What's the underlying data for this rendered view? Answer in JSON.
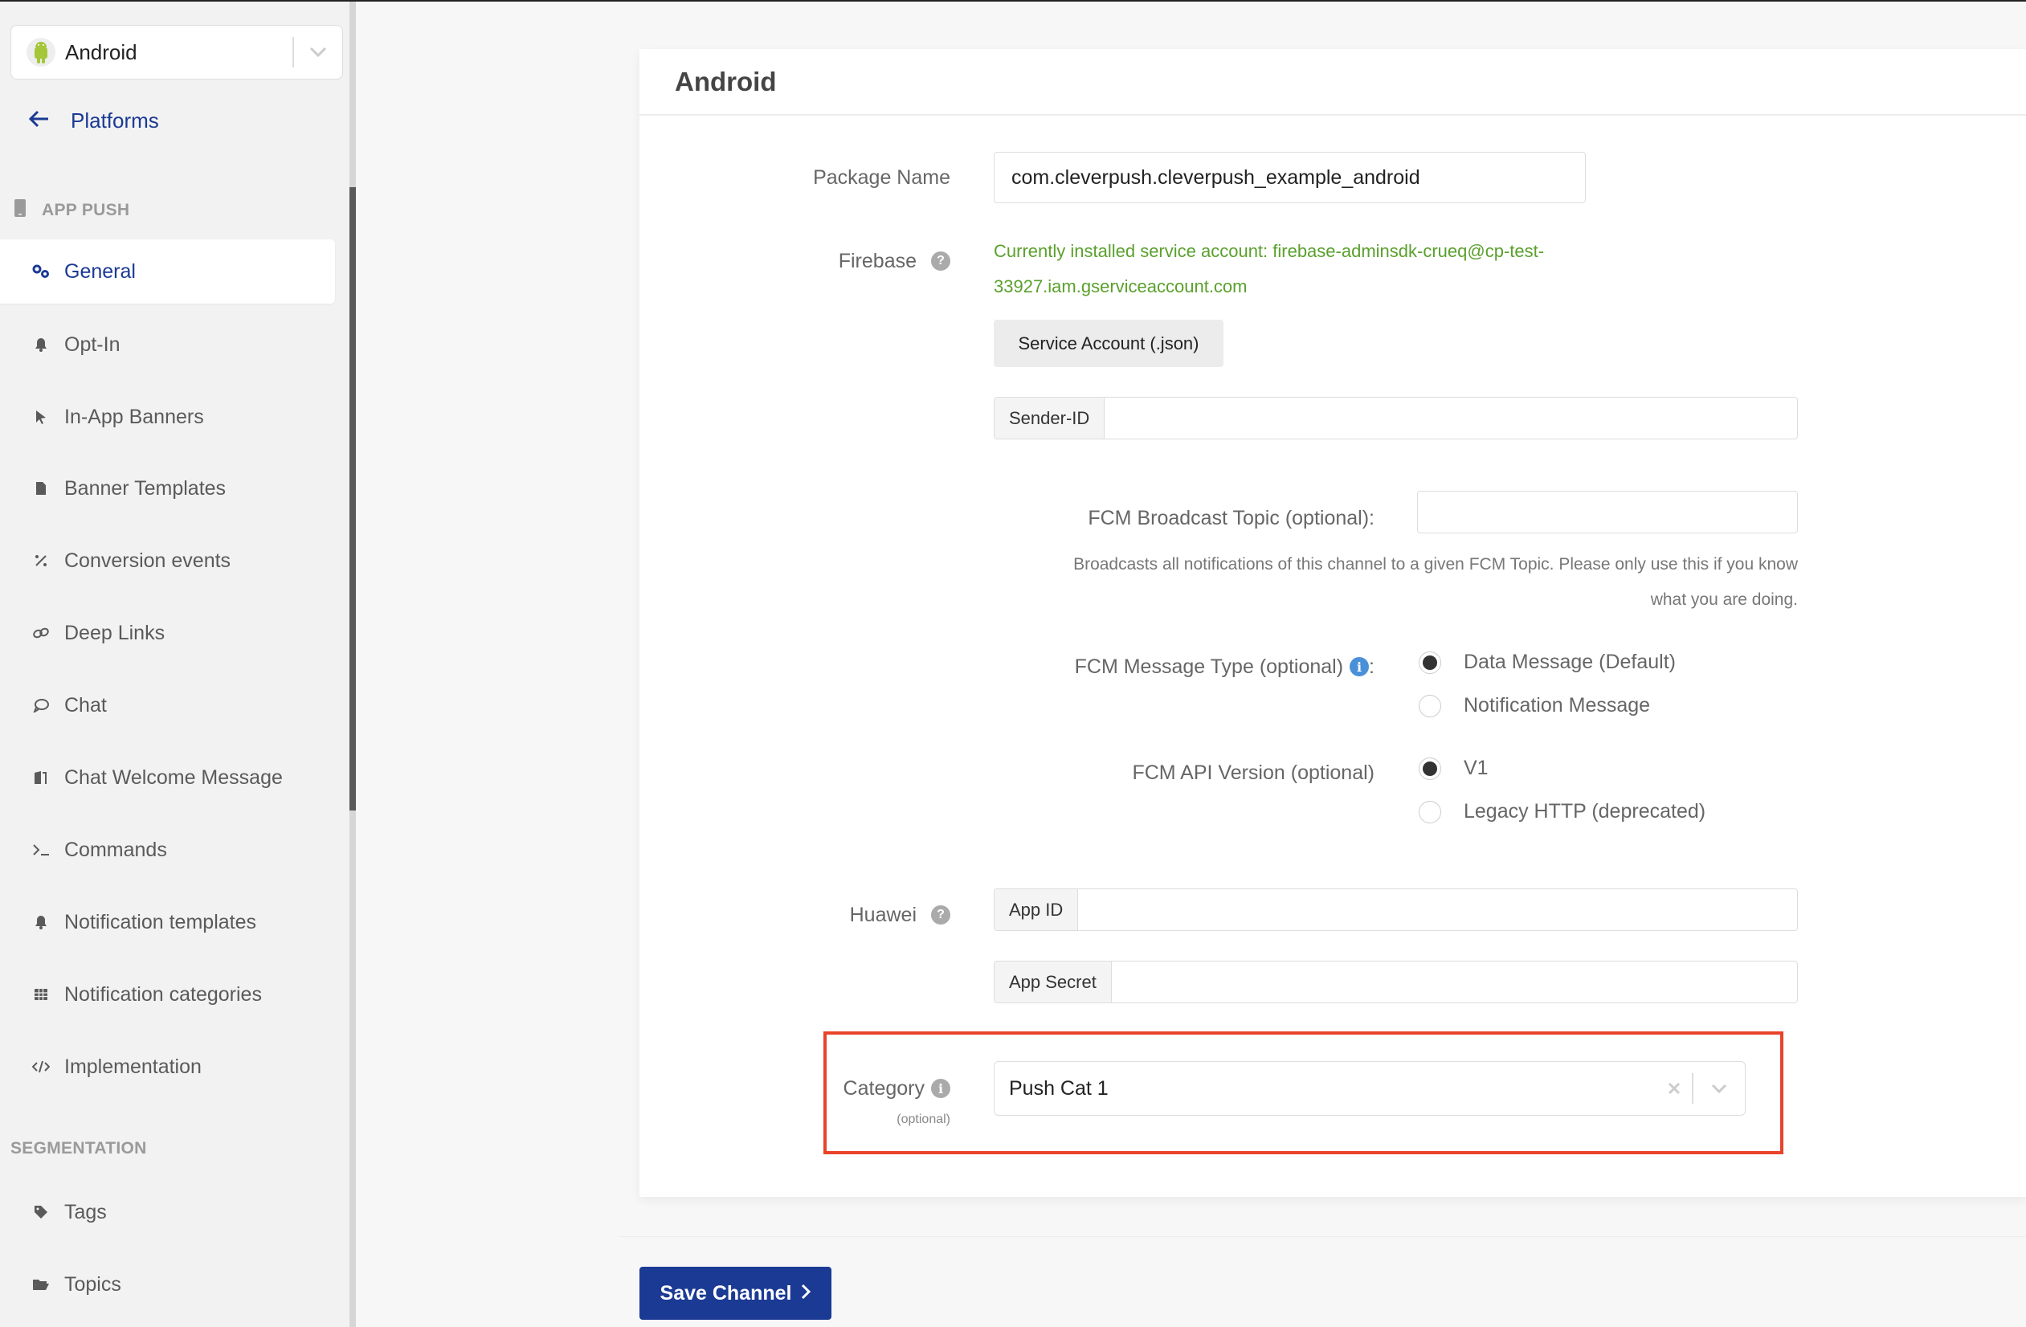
{
  "sidebar": {
    "platform_select": {
      "value": "Android",
      "icon": "android-logo"
    },
    "back_link": {
      "label": "Platforms",
      "icon": "arrow-left-icon"
    },
    "sections": [
      {
        "title": "APP PUSH",
        "icon": "mobile-phone-icon",
        "items": [
          {
            "label": "General",
            "icon": "gears-icon",
            "active": true
          },
          {
            "label": "Opt-In",
            "icon": "bell-icon"
          },
          {
            "label": "In-App Banners",
            "icon": "cursor-pointer-icon"
          },
          {
            "label": "Banner Templates",
            "icon": "file-icon"
          },
          {
            "label": "Conversion events",
            "icon": "percent-icon"
          },
          {
            "label": "Deep Links",
            "icon": "link-icon"
          },
          {
            "label": "Chat",
            "icon": "chat-bubble-icon"
          },
          {
            "label": "Chat Welcome Message",
            "icon": "door-open-icon"
          },
          {
            "label": "Commands",
            "icon": "terminal-icon"
          },
          {
            "label": "Notification templates",
            "icon": "bell-icon"
          },
          {
            "label": "Notification categories",
            "icon": "table-icon"
          },
          {
            "label": "Implementation",
            "icon": "code-icon"
          }
        ]
      },
      {
        "title": "SEGMENTATION",
        "items": [
          {
            "label": "Tags",
            "icon": "tag-icon"
          },
          {
            "label": "Topics",
            "icon": "folder-open-icon"
          }
        ]
      }
    ]
  },
  "card": {
    "title": "Android",
    "package_name": {
      "label": "Package Name",
      "value": "com.cleverpush.cleverpush_example_android"
    },
    "firebase": {
      "label": "Firebase",
      "status_line1": "Currently installed service account: firebase-adminsdk-crueq@cp-test-",
      "status_line2": "33927.iam.gserviceaccount.com",
      "upload_button": "Service Account (.json)",
      "sender_id_addon": "Sender-ID",
      "sender_id_value": ""
    },
    "fcm_broadcast": {
      "label": "FCM Broadcast Topic",
      "optional": "(optional)",
      "colon": ":",
      "value": "",
      "help_line1": "Broadcasts all notifications of this channel to a given FCM Topic. Please only use this if you know",
      "help_line2": "what you are doing."
    },
    "fcm_message_type": {
      "label": "FCM Message Type",
      "optional": "(optional)",
      "colon": ":",
      "options": [
        {
          "label": "Data Message (Default)",
          "checked": true
        },
        {
          "label": "Notification Message",
          "checked": false
        }
      ]
    },
    "fcm_api_version": {
      "label": "FCM API Version",
      "optional": "(optional)",
      "options": [
        {
          "label": "V1",
          "checked": true
        },
        {
          "label": "Legacy HTTP (deprecated)",
          "checked": false
        }
      ]
    },
    "huawei": {
      "label": "Huawei",
      "app_id_addon": "App ID",
      "app_id_value": "",
      "app_secret_addon": "App Secret",
      "app_secret_value": ""
    },
    "category": {
      "label": "Category",
      "optional": "(optional)",
      "value": "Push Cat 1"
    }
  },
  "footer": {
    "save_label": "Save Channel"
  },
  "colors": {
    "brand": "#1b3a94",
    "success_text": "#5aa02c",
    "highlight": "#e8432b",
    "info": "#4a90d9"
  }
}
